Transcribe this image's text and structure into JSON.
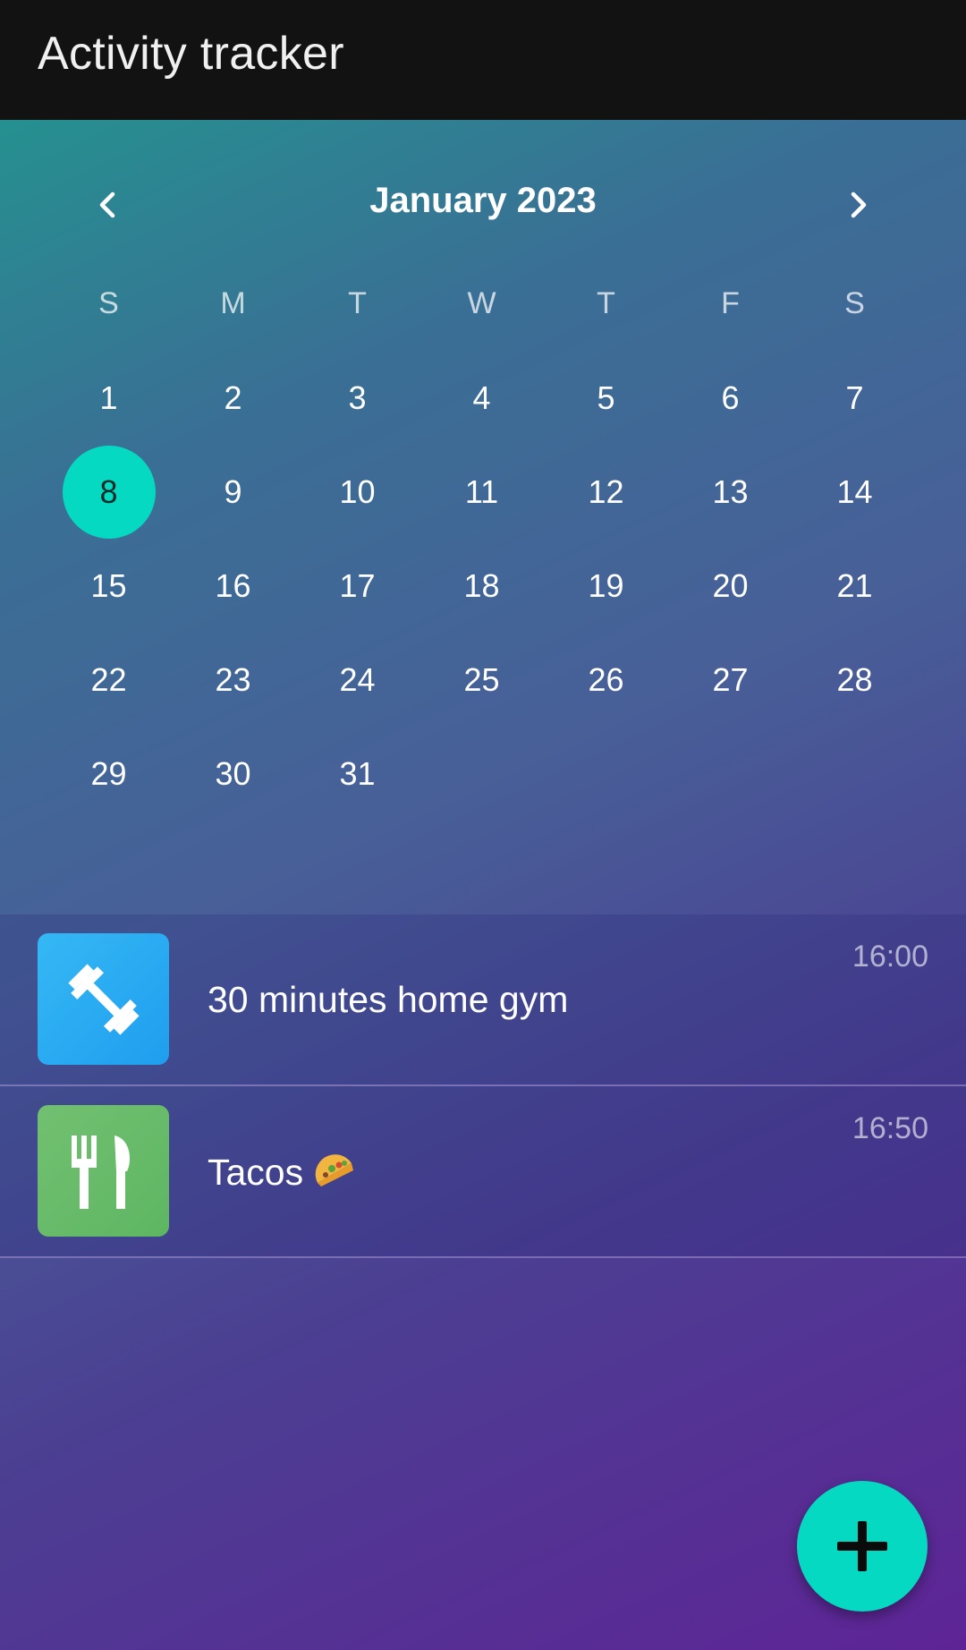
{
  "app": {
    "title": "Activity tracker"
  },
  "calendar": {
    "month_label": "January 2023",
    "prev_icon": "chevron-left-icon",
    "next_icon": "chevron-right-icon",
    "weekdays": [
      "S",
      "M",
      "T",
      "W",
      "T",
      "F",
      "S"
    ],
    "days": [
      "1",
      "2",
      "3",
      "4",
      "5",
      "6",
      "7",
      "8",
      "9",
      "10",
      "11",
      "12",
      "13",
      "14",
      "15",
      "16",
      "17",
      "18",
      "19",
      "20",
      "21",
      "22",
      "23",
      "24",
      "25",
      "26",
      "27",
      "28",
      "29",
      "30",
      "31"
    ],
    "selected_day": "8",
    "selected_color": "#06d9c2"
  },
  "activities": [
    {
      "label": "30 minutes home gym",
      "time": "16:00",
      "icon": "dumbbell-icon",
      "icon_color": "#2aaef2"
    },
    {
      "label": "Tacos",
      "emoji": "taco-emoji",
      "time": "16:50",
      "icon": "fork-knife-icon",
      "icon_color": "#68bb69"
    }
  ],
  "fab": {
    "icon": "plus-icon",
    "color": "#06d9c2"
  }
}
